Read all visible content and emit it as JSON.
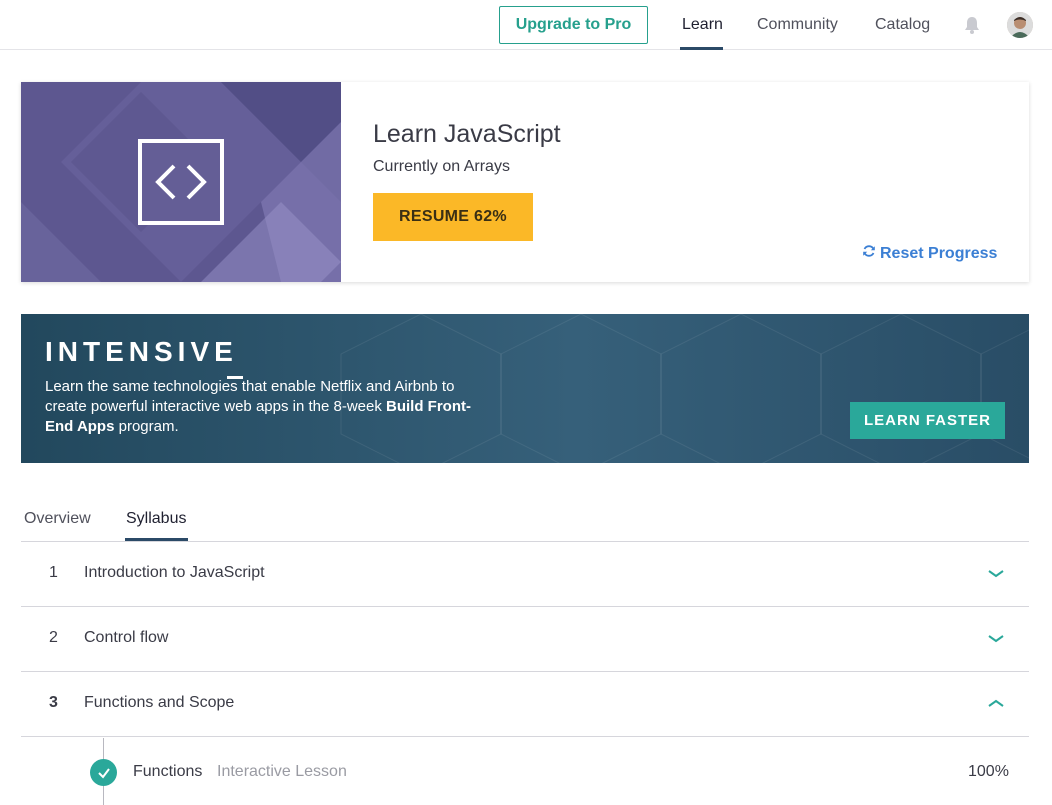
{
  "nav": {
    "upgrade_label": "Upgrade to Pro",
    "links": [
      "Learn",
      "Community",
      "Catalog"
    ],
    "active": "Learn",
    "icons": {
      "bell": "bell-icon",
      "avatar": "user-avatar"
    }
  },
  "course": {
    "title": "Learn JavaScript",
    "current": "Currently on Arrays",
    "resume_label": "RESUME 62%",
    "progress_percent": 62,
    "reset_label": "Reset Progress",
    "hero_icon": "code-brackets-icon",
    "accent": "#fbb827"
  },
  "banner": {
    "title": "INTENSIVE",
    "text_part1": "Learn the same technologies that enable Netflix and Airbnb to create powerful interactive web apps in the 8-week ",
    "text_bold": "Build Front-End Apps",
    "text_part2": " program.",
    "cta_label": "LEARN FASTER"
  },
  "tabs": {
    "items": [
      "Overview",
      "Syllabus"
    ],
    "active": "Syllabus"
  },
  "syllabus": [
    {
      "num": "1",
      "title": "Introduction to JavaScript",
      "expanded": false
    },
    {
      "num": "2",
      "title": "Control flow",
      "expanded": false
    },
    {
      "num": "3",
      "title": "Functions and Scope",
      "expanded": true
    }
  ],
  "lesson": {
    "title": "Functions",
    "type": "Interactive Lesson",
    "percent": "100%",
    "status_icon": "check-icon"
  },
  "colors": {
    "teal": "#26a08d",
    "navy_underline": "#2b4a67",
    "link_blue": "#3b7fd4",
    "hero_purple": "#5c5690",
    "banner_bg": "#2f566e"
  }
}
